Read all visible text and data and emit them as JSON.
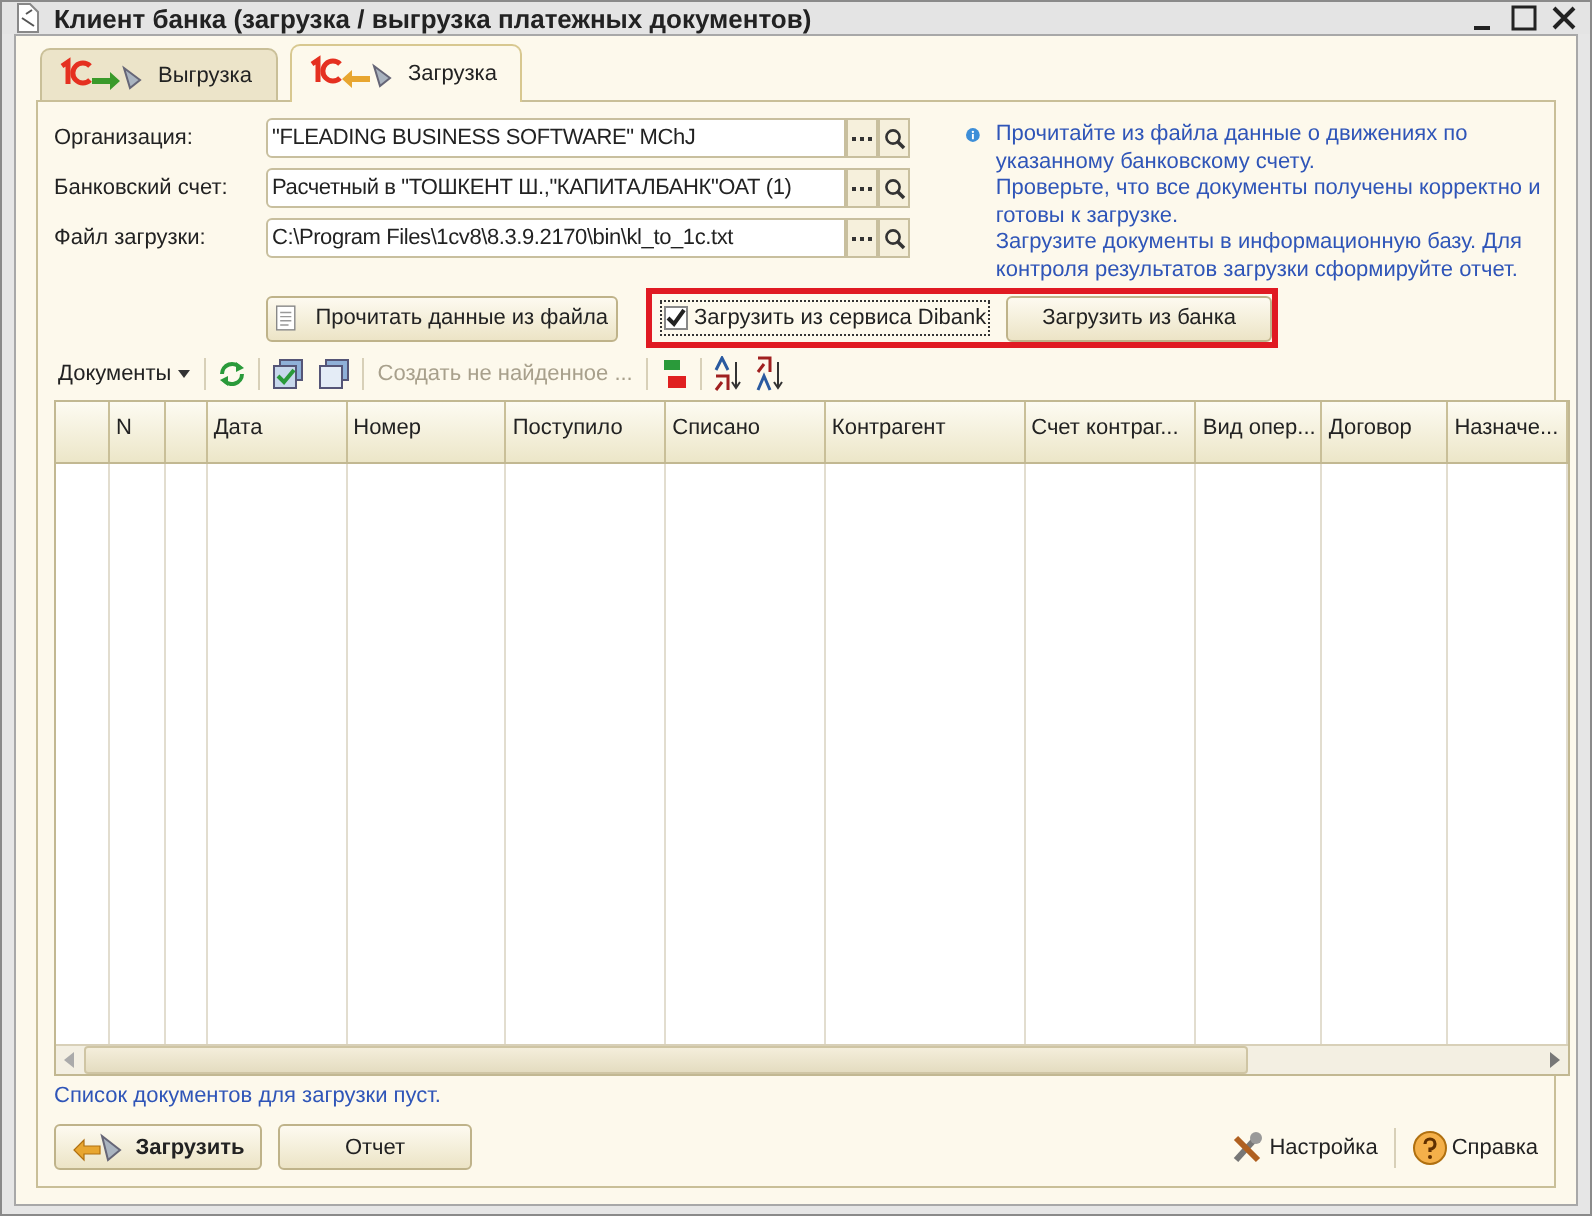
{
  "window": {
    "title": "Клиент банка (загрузка / выгрузка платежных документов)"
  },
  "tabs": [
    {
      "label": "Выгрузка",
      "selected": false,
      "kind": "export"
    },
    {
      "label": "Загрузка",
      "selected": true,
      "kind": "import"
    }
  ],
  "form": [
    {
      "label": "Организация:",
      "value": "\"FLEADING BUSINESS SOFTWARE\" MChJ"
    },
    {
      "label": "Банковский счет:",
      "value": "Расчетный в \"ТОШКЕНТ Ш.,\"КАПИТАЛБАНК\"ОАТ  (1)"
    },
    {
      "label": "Файл загрузки:",
      "value": "C:\\Program Files\\1cv8\\8.3.9.2170\\bin\\kl_to_1c.txt"
    }
  ],
  "info": "Прочитайте из файла данные о движениях по указанному банковскому счету.\nПроверьте, что все  документы получены корректно и готовы к загрузке.\nЗагрузите документы в информационную базу. Для контроля результатов загрузки сформируйте отчет.",
  "read_button": "Прочитать данные из файла",
  "dibank_checkbox": {
    "label": "Загрузить из сервиса Dibank",
    "checked": true
  },
  "bank_button": "Загрузить из банка",
  "toolbar": {
    "menu": "Документы",
    "create": {
      "label": "Создать не найденное ...",
      "disabled": true
    }
  },
  "table": {
    "columns": [
      {
        "kind": "blank"
      },
      {
        "kind": "text",
        "heading": "N"
      },
      {
        "kind": "blank"
      },
      {
        "kind": "text",
        "heading": "Дата"
      },
      {
        "kind": "text",
        "heading": "Номер"
      },
      {
        "kind": "text",
        "heading": "Поступило"
      },
      {
        "kind": "text",
        "heading": "Списано"
      },
      {
        "kind": "text",
        "heading": "Контрагент"
      },
      {
        "kind": "text",
        "heading": "Счет контраг..."
      },
      {
        "kind": "text",
        "heading": "Вид опер..."
      },
      {
        "kind": "text",
        "heading": "Договор"
      },
      {
        "kind": "text",
        "heading": "Назначе..."
      }
    ]
  },
  "status": "Список документов для загрузки пуст.",
  "buttons": [
    {
      "label": "Загрузить",
      "kind": "primary"
    },
    {
      "label": "Отчет",
      "kind": "plain"
    }
  ],
  "links": [
    {
      "label": "Настройка",
      "kind": "settings"
    },
    {
      "label": "Справка",
      "kind": "help"
    }
  ]
}
